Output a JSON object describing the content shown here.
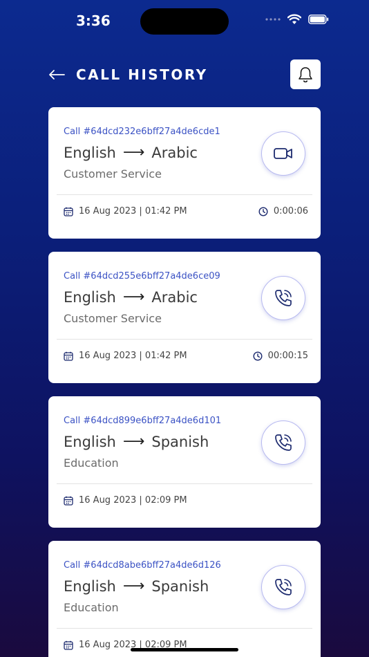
{
  "status_bar": {
    "time": "3:36"
  },
  "header": {
    "title": "CALL HISTORY"
  },
  "calls": [
    {
      "id": "Call #64dcd232e6bff27a4de6cde1",
      "from": "English",
      "to": "Arabic",
      "category": "Customer Service",
      "date": "16 Aug 2023 | 01:42 PM",
      "duration": "0:00:06",
      "type": "video-icon"
    },
    {
      "id": "Call #64dcd255e6bff27a4de6ce09",
      "from": "English",
      "to": "Arabic",
      "category": "Customer Service",
      "date": "16 Aug 2023 | 01:42 PM",
      "duration": "00:00:15",
      "type": "phone-icon"
    },
    {
      "id": "Call #64dcd899e6bff27a4de6d101",
      "from": "English",
      "to": "Spanish",
      "category": "Education",
      "date": "16 Aug 2023 | 02:09 PM",
      "duration": "",
      "type": "phone-icon"
    },
    {
      "id": "Call #64dcd8abe6bff27a4de6d126",
      "from": "English",
      "to": "Spanish",
      "category": "Education",
      "date": "16 Aug 2023 | 02:09 PM",
      "duration": "",
      "type": "phone-icon"
    }
  ],
  "colors": {
    "accent": "#3b52c4",
    "icon": "#1c2a6e"
  }
}
